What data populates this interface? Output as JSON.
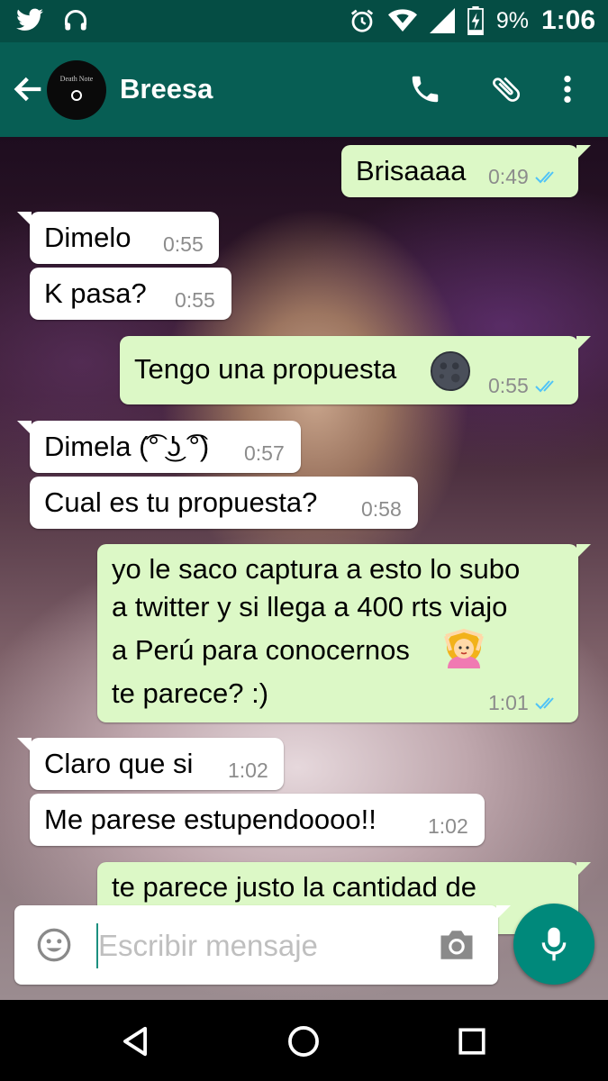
{
  "status_bar": {
    "battery_percent": "9%",
    "time": "1:06",
    "icons": [
      "twitter-icon",
      "headset-icon",
      "alarm-icon",
      "wifi-icon",
      "signal-icon",
      "battery-charging-icon"
    ]
  },
  "header": {
    "contact_name": "Breesa",
    "avatar_text": "Death Note",
    "icons": [
      "back-arrow-icon",
      "phone-icon",
      "paperclip-icon",
      "more-vert-icon"
    ]
  },
  "messages": [
    {
      "dir": "out",
      "text": "Brisaaaa",
      "time": "0:49",
      "read": true
    },
    {
      "dir": "in",
      "text": "Dimelo",
      "time": "0:55"
    },
    {
      "dir": "in",
      "text": "K pasa?",
      "time": "0:55"
    },
    {
      "dir": "out",
      "text": "Tengo una propuesta",
      "emoji": "new-moon-face-emoji",
      "time": "0:55",
      "read": true
    },
    {
      "dir": "in",
      "text": "Dimela (͡° ͜ʖ ͡°)",
      "time": "0:57"
    },
    {
      "dir": "in",
      "text": "Cual es tu propuesta?",
      "time": "0:58"
    },
    {
      "dir": "out",
      "lines": [
        "yo le saco captura a esto lo subo",
        "a twitter y si llega a 400 rts viajo",
        "a Perú para conocernos",
        "te parece? :)"
      ],
      "emoji": "woman-gesturing-ok-emoji",
      "time": "1:01",
      "read": true
    },
    {
      "dir": "in",
      "text": "Claro que si",
      "time": "1:02"
    },
    {
      "dir": "in",
      "text": "Me parese estupendoooo!!",
      "time": "1:02"
    },
    {
      "dir": "out",
      "text": "te parece justo la cantidad de"
    }
  ],
  "composer": {
    "placeholder": "Escribir mensaje",
    "icons": [
      "emoji-icon",
      "camera-icon",
      "microphone-icon"
    ]
  },
  "nav_bar": {
    "icons": [
      "back-triangle-icon",
      "home-circle-icon",
      "recents-square-icon"
    ]
  },
  "colors": {
    "status_bar": "#054d44",
    "app_bar": "#075e54",
    "outgoing_bubble": "#dcf8c6",
    "incoming_bubble": "#ffffff",
    "read_ticks": "#4fc3f7",
    "mic_button": "#00897b"
  }
}
